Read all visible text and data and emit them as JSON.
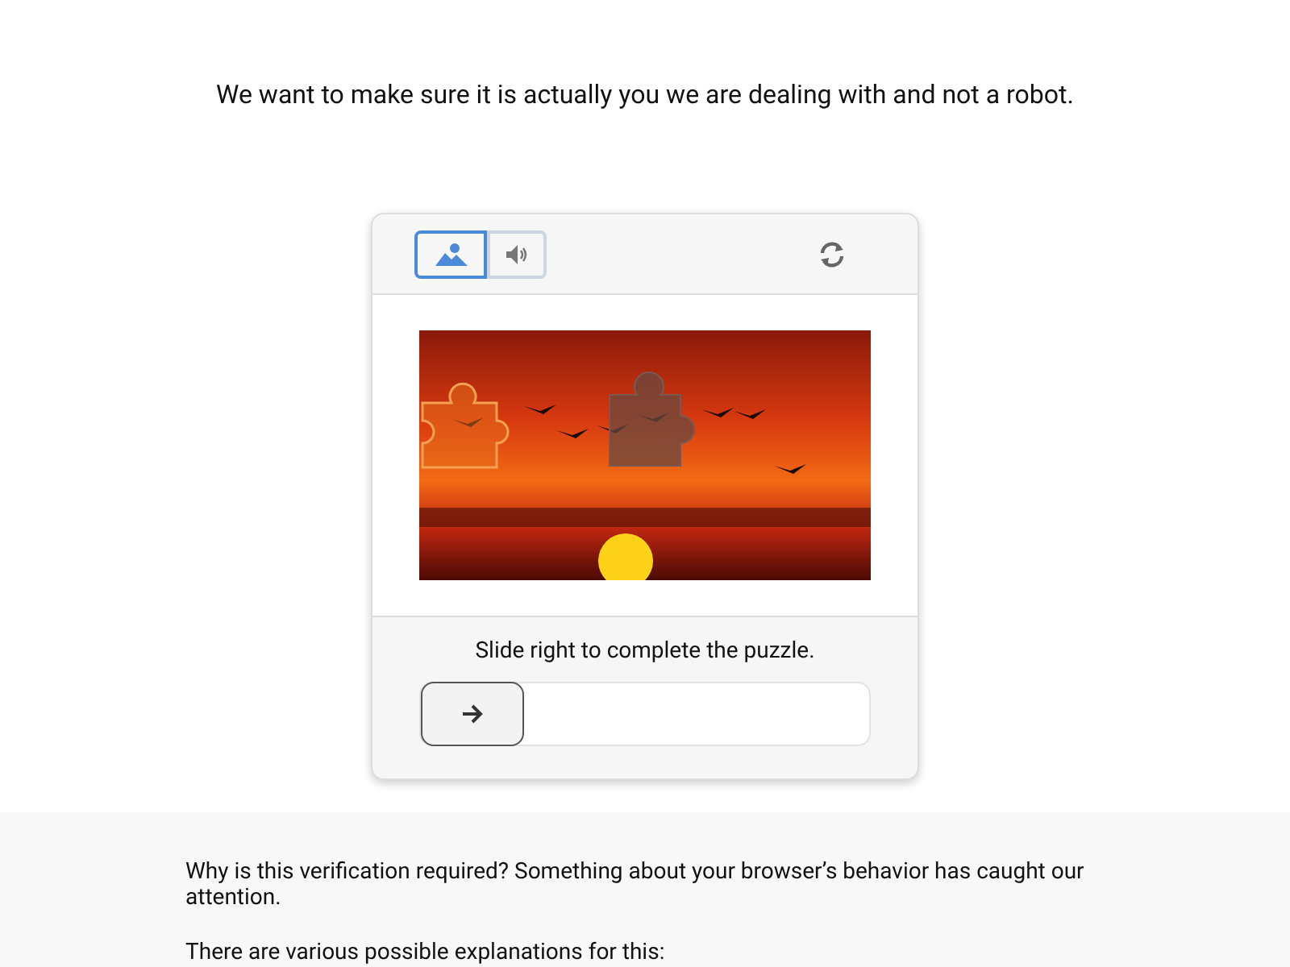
{
  "heading": "We want to make sure it is actually you we are dealing with and not a robot.",
  "mode_tabs": [
    {
      "kind": "image",
      "selected": true
    },
    {
      "kind": "audio",
      "selected": false
    }
  ],
  "instruction": "Slide right to complete the puzzle.",
  "slider": {
    "level": 0
  },
  "info": [
    "Why is this verification required? Something about your browser’s behavior has caught our attention.",
    "There are various possible explanations for this:"
  ]
}
